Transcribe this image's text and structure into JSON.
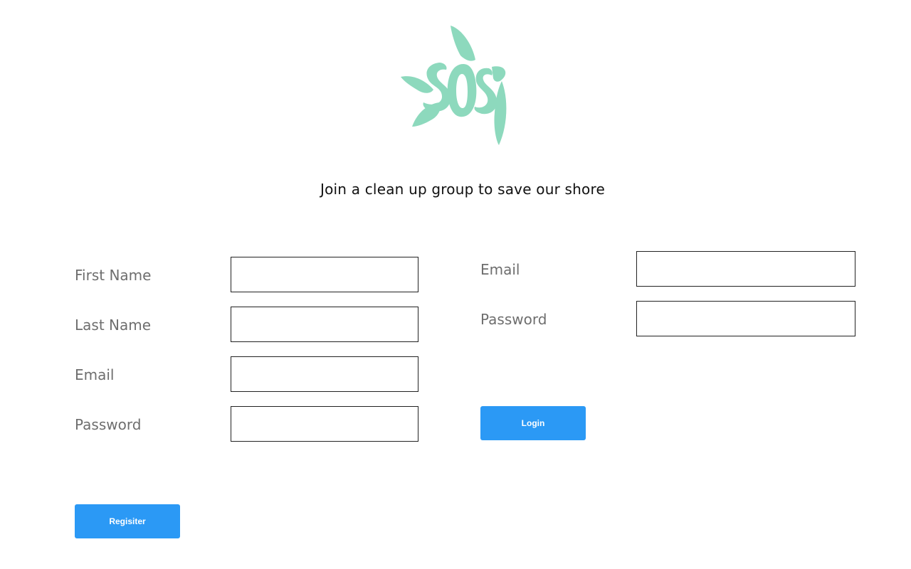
{
  "logo": {
    "name": "sos-turtle-logo",
    "color": "#8dd9bd"
  },
  "tagline": "Join a clean up group to save our shore",
  "register": {
    "fields": [
      {
        "label": "First Name",
        "value": "",
        "type": "text"
      },
      {
        "label": "Last Name",
        "value": "",
        "type": "text"
      },
      {
        "label": "Email",
        "value": "",
        "type": "email"
      },
      {
        "label": "Password",
        "value": "",
        "type": "password"
      }
    ],
    "button": "Regisiter"
  },
  "login": {
    "fields": [
      {
        "label": "Email",
        "value": "",
        "type": "email"
      },
      {
        "label": "Password",
        "value": "",
        "type": "password"
      }
    ],
    "button": "Login"
  },
  "colors": {
    "accent": "#2b99f5",
    "logo": "#8dd9bd",
    "label": "#6e6e6e",
    "border": "#222222"
  }
}
